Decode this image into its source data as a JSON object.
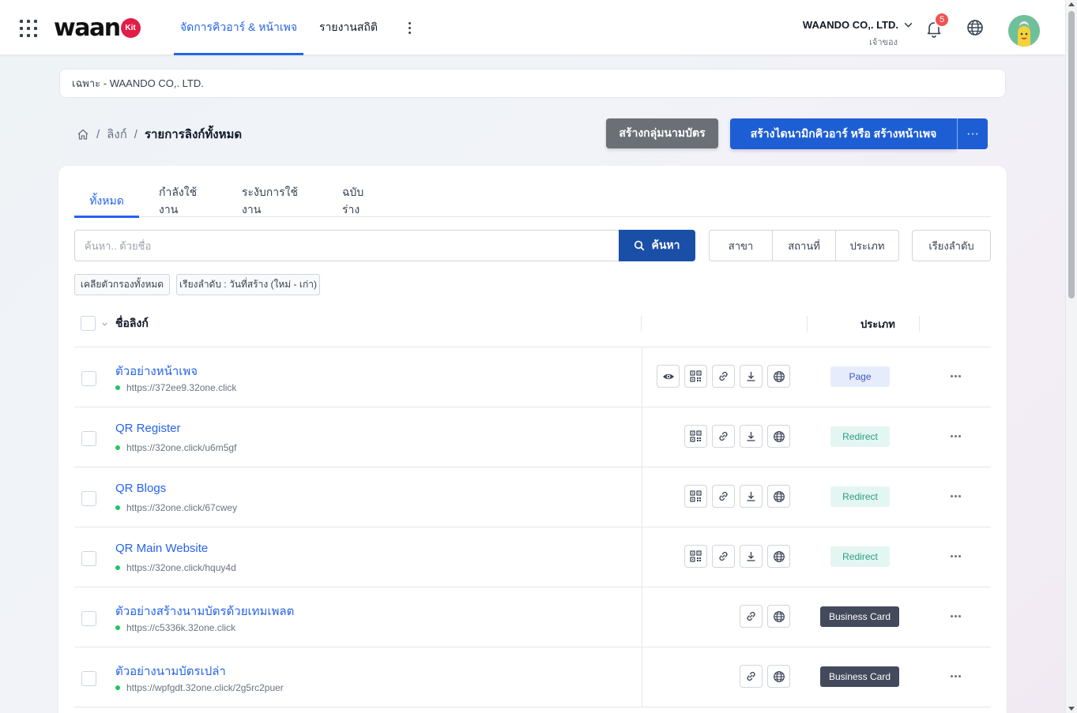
{
  "header": {
    "logo_text": "waan",
    "logo_badge": "Kit",
    "nav": [
      {
        "label": "จัดการคิวอาร์ & หน้าเพจ"
      },
      {
        "label": "รายงานสถิติ"
      }
    ],
    "org_name": "WAANDO CO,. LTD.",
    "org_role": "เจ้าของ",
    "notification_count": "5"
  },
  "scope": {
    "label": "เฉพาะ - WAANDO CO,. LTD."
  },
  "breadcrumb": {
    "items": [
      "ลิงก์"
    ],
    "current": "รายการลิงก์ทั้งหมด"
  },
  "actions": {
    "create_group": "สร้างกลุ่มนามบัตร",
    "create_main": "สร้างไดนามิกคิวอาร์ หรือ สร้างหน้าเพจ",
    "more": "···"
  },
  "tabs": [
    {
      "label": "ทั้งหมด"
    },
    {
      "label": "กำลังใช้งาน"
    },
    {
      "label": "ระงับการใช้งาน"
    },
    {
      "label": "ฉบับร่าง"
    }
  ],
  "search": {
    "placeholder": "ค้นหา.. ด้วยชื่อ",
    "button": "ค้นหา"
  },
  "filters": [
    "สาขา",
    "สถานที่",
    "ประเภท"
  ],
  "sort_label": "เรียงลำดับ",
  "chips": [
    "เคลียตัวกรองทั้งหมด",
    "เรียงลำดับ : วันที่สร้าง (ใหม่ - เก่า)"
  ],
  "table": {
    "col_name": "ชื่อลิงก์",
    "col_type": "ประเภท",
    "rows": [
      {
        "title": "ตัวอย่างหน้าเพจ",
        "url": "https://372ee9.32one.click",
        "type": "Page",
        "actions": [
          "eye-icon",
          "qr-icon",
          "link-icon",
          "download-icon",
          "globe-icon"
        ]
      },
      {
        "title": "QR Register",
        "url": "https://32one.click/u6m5gf",
        "type": "Redirect",
        "actions": [
          "qr-icon",
          "link-icon",
          "download-icon",
          "globe-icon"
        ]
      },
      {
        "title": "QR Blogs",
        "url": "https://32one.click/67cwey",
        "type": "Redirect",
        "actions": [
          "qr-icon",
          "link-icon",
          "download-icon",
          "globe-icon"
        ]
      },
      {
        "title": "QR Main Website",
        "url": "https://32one.click/hquy4d",
        "type": "Redirect",
        "actions": [
          "qr-icon",
          "link-icon",
          "download-icon",
          "globe-icon"
        ]
      },
      {
        "title": "ตัวอย่างสร้างนามบัตรด้วยเทมเพลต",
        "url": "https://c5336k.32one.click",
        "type": "Business Card",
        "actions": [
          "link-icon",
          "globe-icon"
        ]
      },
      {
        "title": "ตัวอย่างนามบัตรเปล่า",
        "url": "https://wpfgdt.32one.click/2g5rc2puer",
        "type": "Business Card",
        "actions": [
          "link-icon",
          "globe-icon"
        ]
      }
    ]
  },
  "colors": {
    "primary": "#2563eb",
    "primary_dark": "#1a4fa8",
    "button_blue": "#1e5ed4",
    "button_gray": "#6b7076",
    "status_active": "#22c55e",
    "badge_page_bg": "#e6ecfb",
    "badge_redirect_bg": "#e4f6f1",
    "badge_bcard_bg": "#434a5c",
    "notification": "#f05252"
  }
}
